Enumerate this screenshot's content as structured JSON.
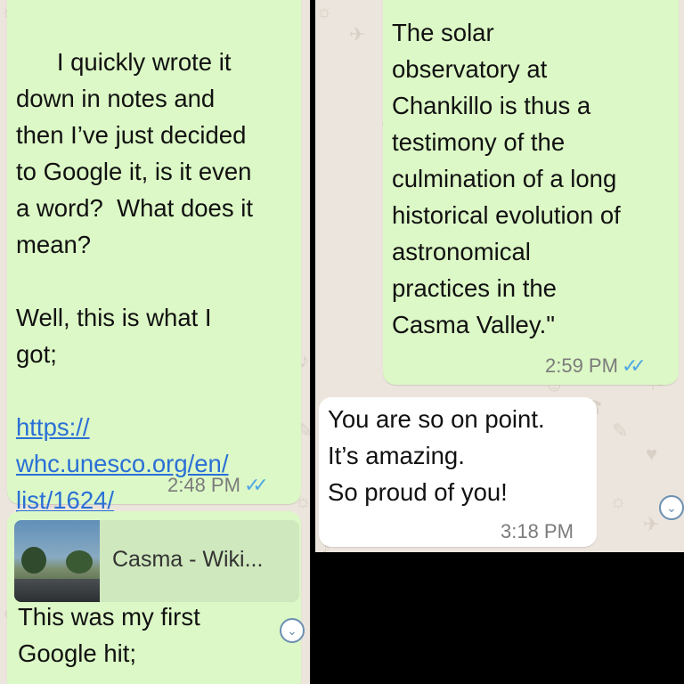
{
  "left_panel": {
    "message_1": {
      "text": "I quickly wrote it\ndown in notes and\nthen I’ve just decided\nto Google it, is it even\na word?  What does it\nmean?\n\nWell, this is what I\ngot;\n\n",
      "link_line_1": "https://",
      "link_line_2": "whc.unesco.org/en/",
      "link_line_3": "list/1624/",
      "time": "2:48 PM",
      "status_icon": "double-check-read-icon"
    },
    "message_2": {
      "preview_title": "Casma - Wiki...",
      "text": "This was my first\nGoogle hit;",
      "menu_icon": "chevron-down-icon"
    }
  },
  "right_panel": {
    "message_1": {
      "text": "The solar\nobservatory at\nChankillo is thus a\ntestimony of the\nculmination of a long\nhistorical evolution of\nastronomical\npractices in the\nCasma Valley.\"",
      "time": "2:59 PM",
      "status_icon": "double-check-read-icon"
    },
    "message_2": {
      "text": "You are so on point.\nIt’s amazing.\nSo proud of you!",
      "time": "3:18 PM",
      "menu_icon": "chevron-down-icon"
    }
  },
  "colors": {
    "outgoing_bubble": "#dcf8c6",
    "incoming_bubble": "#ffffff",
    "link": "#2a6fd6",
    "read_ticks": "#4fa7e6",
    "wallpaper": "#ece5dd"
  }
}
